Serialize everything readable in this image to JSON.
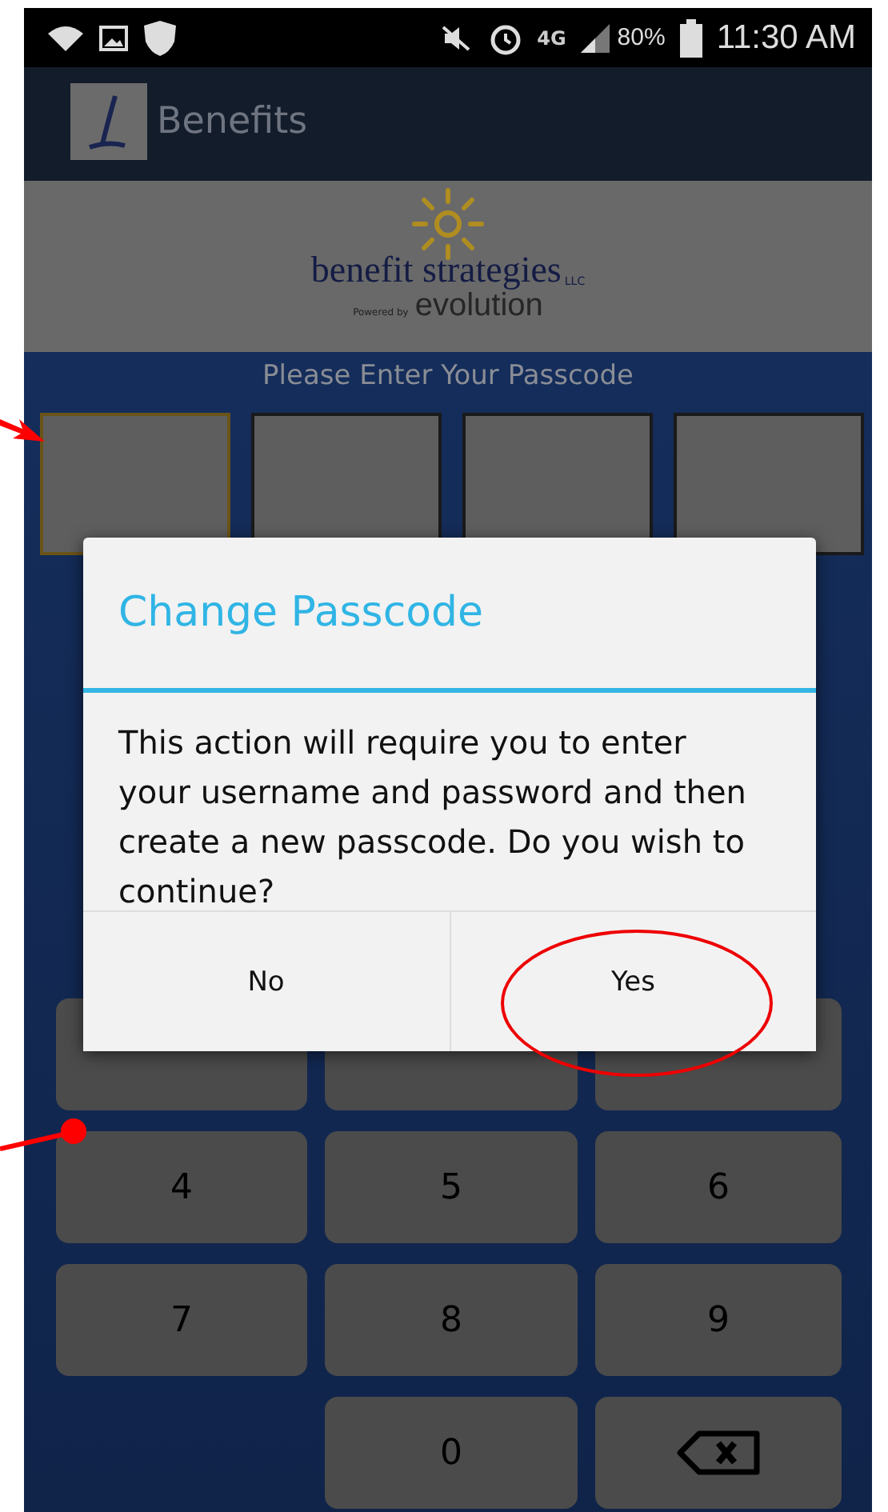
{
  "status_bar": {
    "network": "4G",
    "battery": "80%",
    "time": "11:30 AM"
  },
  "app_bar": {
    "title": "Benefits"
  },
  "banner": {
    "brand": "benefit strategies",
    "suffix": "LLC",
    "powered_by": "Powered by",
    "partner": "evolution"
  },
  "prompt": "Please Enter Your Passcode",
  "digit_boxes": [
    {
      "selected": true
    },
    {
      "selected": false
    },
    {
      "selected": false
    },
    {
      "selected": false
    }
  ],
  "keypad": [
    {
      "kind": "covered"
    },
    {
      "kind": "covered"
    },
    {
      "kind": "covered"
    },
    {
      "kind": "digit",
      "label": "4"
    },
    {
      "kind": "digit",
      "label": "5"
    },
    {
      "kind": "digit",
      "label": "6"
    },
    {
      "kind": "digit",
      "label": "7"
    },
    {
      "kind": "digit",
      "label": "8"
    },
    {
      "kind": "digit",
      "label": "9"
    },
    {
      "kind": "blank"
    },
    {
      "kind": "digit",
      "label": "0"
    },
    {
      "kind": "backspace"
    }
  ],
  "dialog": {
    "title": "Change Passcode",
    "message": "This action will require you to enter your username and password and then create a new passcode. Do you wish to continue?",
    "buttons": [
      {
        "label": "No"
      },
      {
        "label": "Yes"
      }
    ]
  }
}
